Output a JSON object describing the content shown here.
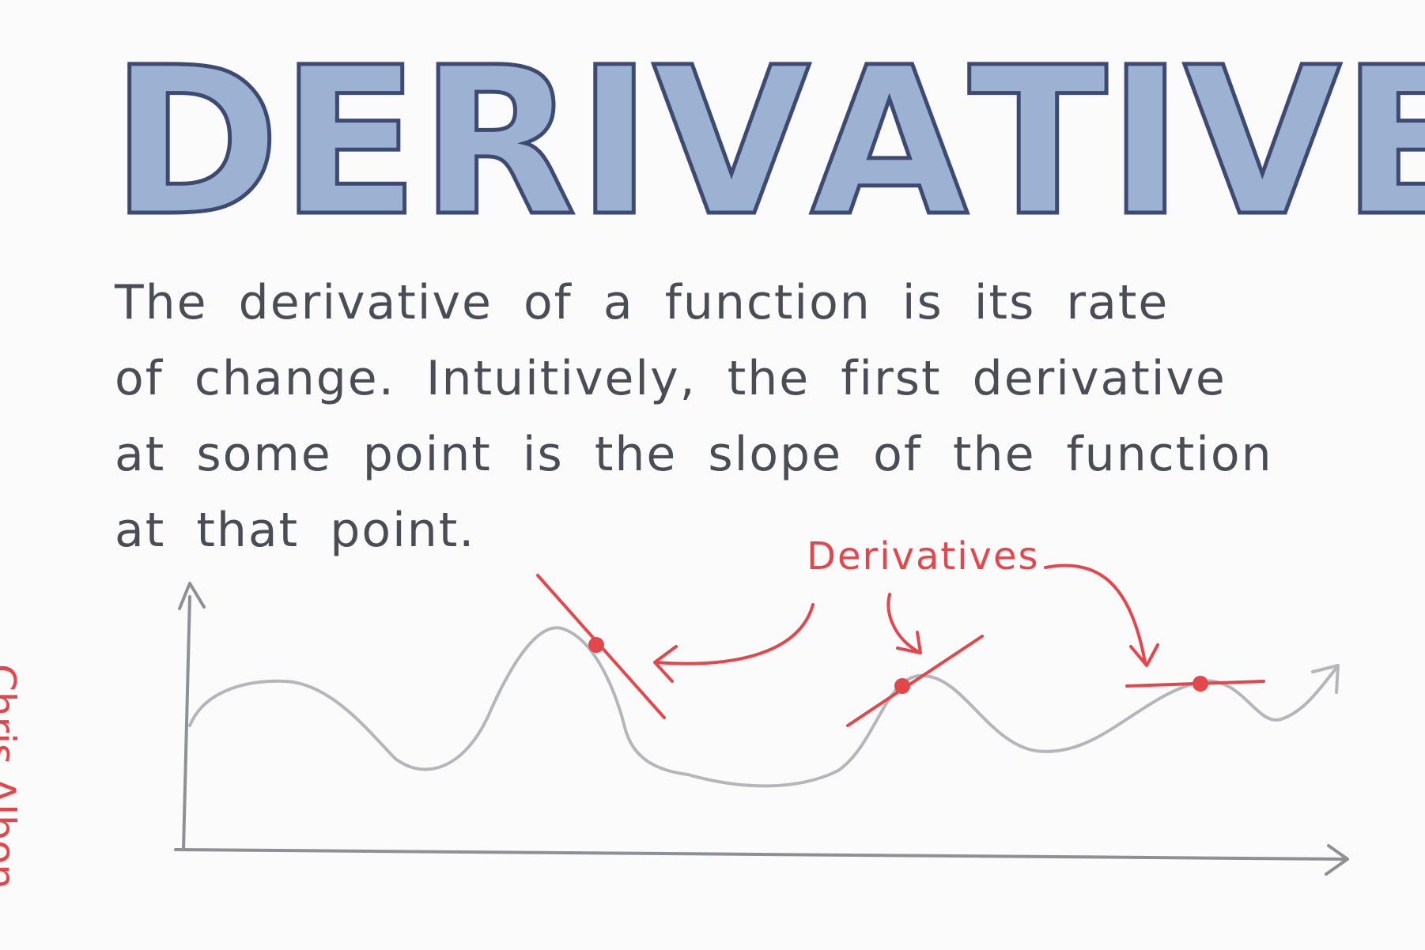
{
  "title": "DERIVATIVE",
  "body_lines": [
    "The derivative of a function is its rate",
    "of change. Intuitively, the first derivative",
    "at some point is the slope of the function",
    "at that point."
  ],
  "annotation": "Derivatives",
  "signature": "Chris Albon",
  "colors": {
    "title_fill": "#9db1d3",
    "title_stroke": "#3d4a72",
    "text": "#4a4d55",
    "axis": "#8f9095",
    "curve": "#b5b6ba",
    "accent": "#e3474b"
  }
}
